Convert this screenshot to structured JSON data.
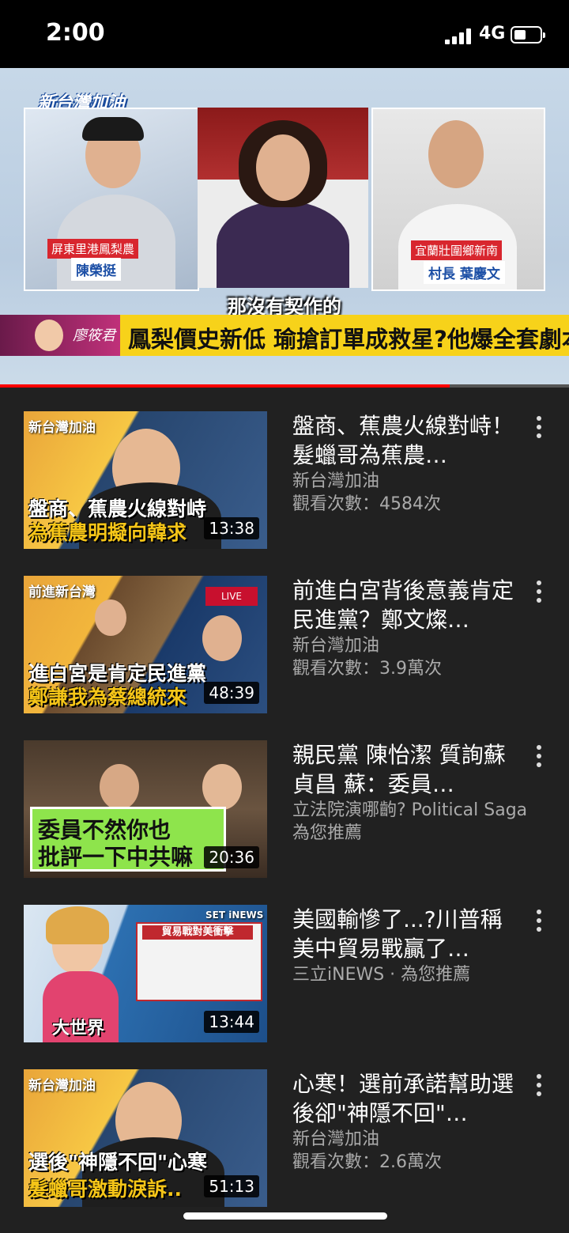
{
  "status_bar": {
    "time": "2:00",
    "network": "4G",
    "battery_level": 0.45
  },
  "player": {
    "show_logo": "新台灣加油",
    "left_guest_caption": "屏東里港鳳梨農",
    "left_guest_name": "陳榮挺",
    "right_guest_caption": "宜蘭壯圍鄉新南",
    "right_guest_name": "村長 葉慶文",
    "subtitle": "那沒有契作的",
    "host_sign": "廖筱君",
    "banner_text": "鳳梨價史新低 瑜搶訂單成救星?他爆全套劇本...",
    "progress": 0.79
  },
  "videos": [
    {
      "thumb_tag": "新台灣加油",
      "thumb_caption_1": "盤商、蕉農火線對峙",
      "thumb_caption_2": "為蕉農明擬向韓求",
      "duration": "13:38",
      "title": "盤商、蕉農火線對峙！髮蠟哥為蕉農…",
      "channel": "新台灣加油",
      "stat": "觀看次數：4584次"
    },
    {
      "thumb_tag": "前進新台灣",
      "thumb_caption_1": "進白宮是肯定民進黨",
      "thumb_caption_2": "鄭謙我為蔡總統來",
      "duration": "48:39",
      "title": "前進白宮背後意義肯定民進黨？鄭文燦…",
      "channel": "新台灣加油",
      "stat": "觀看次數：3.9萬次"
    },
    {
      "thumb_tag": "",
      "thumb_caption_1": "委員不然你也",
      "thumb_caption_2": "批評一下中共嘛",
      "duration": "20:36",
      "title": "親民黨 陳怡潔 質詢蘇貞昌 蘇：委員…",
      "channel": "立法院演哪齣? Political Saga",
      "stat": "為您推薦"
    },
    {
      "thumb_tag": "SET iNEWS",
      "thumb_caption_1": "貿易戰對美衝擊",
      "thumb_caption_2": "大世界",
      "duration": "13:44",
      "title": "美國輸慘了...?川普稱美中貿易戰贏了…",
      "channel": "三立iNEWS · 為您推薦",
      "stat": ""
    },
    {
      "thumb_tag": "新台灣加油",
      "thumb_caption_1": "選後\"神隱不回\"心寒",
      "thumb_caption_2": "髮蠟哥激動淚訴..",
      "duration": "51:13",
      "title": "心寒！選前承諾幫助選後卻\"神隱不回\"…",
      "channel": "新台灣加油",
      "stat": "觀看次數：2.6萬次"
    }
  ],
  "colors": {
    "background": "#212121",
    "progress_played": "#ff0000",
    "caption_yellow": "#f5c518",
    "caption_green_bg": "#8ee44c"
  }
}
